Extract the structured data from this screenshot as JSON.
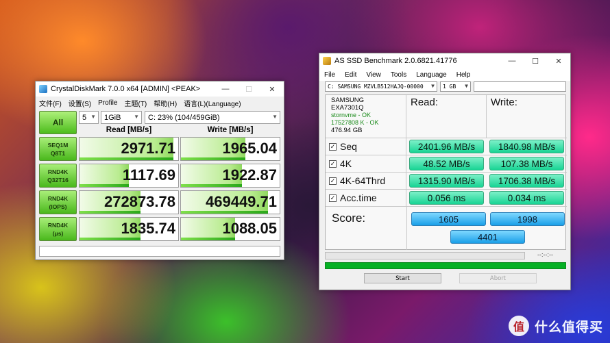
{
  "cdm": {
    "title": "CrystalDiskMark 7.0.0 x64 [ADMIN] <PEAK>",
    "controls": {
      "minimize": "—",
      "maximize": "☐",
      "close": "✕"
    },
    "menu": [
      "文件(F)",
      "设置(S)",
      "Profile",
      "主题(T)",
      "帮助(H)",
      "语言(L)(Language)"
    ],
    "all_button": "All",
    "count": "5",
    "size": "1GiB",
    "drive": "C: 23% (104/459GiB)",
    "read_header": "Read [MB/s]",
    "write_header": "Write [MB/s]",
    "rows": [
      {
        "label1": "SEQ1M",
        "label2": "Q8T1",
        "read": "2971.71",
        "write": "1965.04",
        "read_fill": 0.95,
        "write_fill": 0.65
      },
      {
        "label1": "RND4K",
        "label2": "Q32T16",
        "read": "1117.69",
        "write": "1922.87",
        "read_fill": 0.5,
        "write_fill": 0.62
      },
      {
        "label1": "RND4K",
        "label2": "(IOPS)",
        "read": "272873.78",
        "write": "469449.71",
        "read_fill": 0.62,
        "write_fill": 0.88
      },
      {
        "label1": "RND4K",
        "label2": "(μs)",
        "read": "1835.74",
        "write": "1088.05",
        "read_fill": 0.62,
        "write_fill": 0.55
      }
    ]
  },
  "asssd": {
    "title": "AS SSD Benchmark 2.0.6821.41776",
    "controls": {
      "minimize": "—",
      "maximize": "☐",
      "close": "✕"
    },
    "menu": [
      "File",
      "Edit",
      "View",
      "Tools",
      "Language",
      "Help"
    ],
    "drive": "C: SAMSUNG MZVLB512HAJQ-00000",
    "size": "1 GB",
    "info": {
      "vendor": "SAMSUNG",
      "model": "EXA7301Q",
      "driver": "stornvme - OK",
      "offset": "17527808 K - OK",
      "capacity": "476.94 GB"
    },
    "read_header": "Read:",
    "write_header": "Write:",
    "check": "☑",
    "rows": [
      {
        "label": "Seq",
        "read": "2401.96 MB/s",
        "write": "1840.98 MB/s"
      },
      {
        "label": "4K",
        "read": "48.52 MB/s",
        "write": "107.38 MB/s"
      },
      {
        "label": "4K-64Thrd",
        "read": "1315.90 MB/s",
        "write": "1706.38 MB/s"
      },
      {
        "label": "Acc.time",
        "read": "0.056 ms",
        "write": "0.034 ms"
      }
    ],
    "score_label": "Score:",
    "score_read": "1605",
    "score_write": "1998",
    "score_total": "4401",
    "elapsed": "--:--:--",
    "start": "Start",
    "abort": "Abort"
  },
  "watermark": {
    "logo": "值",
    "text": "什么值得买"
  }
}
